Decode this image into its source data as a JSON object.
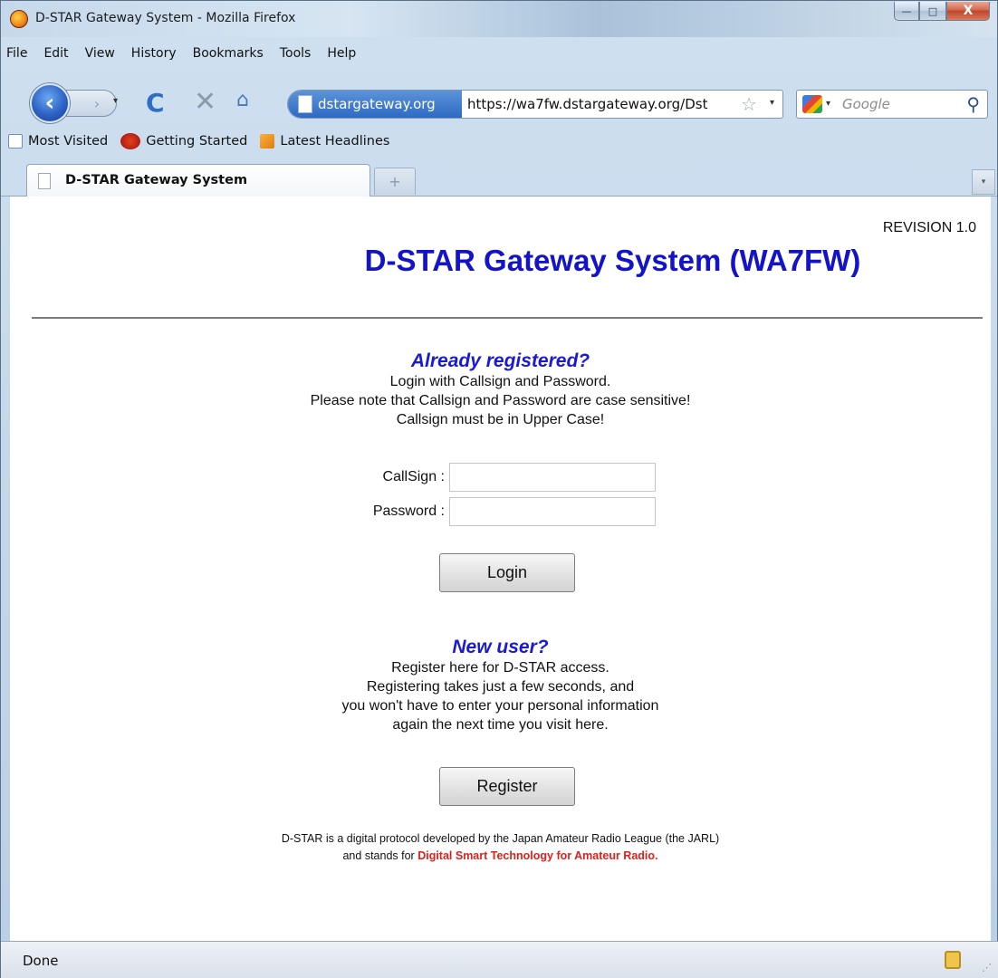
{
  "window": {
    "title": "D-STAR Gateway System - Mozilla Firefox",
    "min_icon": "—",
    "max_icon": "□",
    "close_icon": "X"
  },
  "menu": [
    "File",
    "Edit",
    "View",
    "History",
    "Bookmarks",
    "Tools",
    "Help"
  ],
  "nav": {
    "back_glyph": "‹",
    "forward_glyph": "›",
    "dropdown_glyph": "▾",
    "reload_glyph": "C",
    "stop_glyph": "✕",
    "home_glyph": "⌂",
    "identity_label": "dstargateway.org",
    "url": "https://wa7fw.dstargateway.org/Dst",
    "star_glyph": "☆",
    "search_placeholder": "Google",
    "search_glyph": "⚲"
  },
  "bookmarks": [
    "Most Visited",
    "Getting Started",
    "Latest Headlines"
  ],
  "tabs": {
    "active_label": "D-STAR Gateway System",
    "new_tab_glyph": "+",
    "list_glyph": "▾"
  },
  "page": {
    "revision": "REVISION 1.0",
    "title": "D-STAR Gateway System (WA7FW)",
    "login_heading": "Already registered?",
    "login_lines": [
      "Login with Callsign and Password.",
      "Please note that Callsign and Password are case sensitive!",
      "Callsign must be in Upper Case!"
    ],
    "callsign_label": "CallSign :",
    "callsign_value": "",
    "password_label": "Password :",
    "password_value": "",
    "login_button": "Login",
    "new_user_heading": "New user?",
    "new_user_lines": [
      "Register here for D-STAR access.",
      "Registering takes just a few seconds, and",
      "you won't have to enter your personal information",
      "again the next time you visit here."
    ],
    "register_button": "Register",
    "footer_line1": "D-STAR is a digital protocol developed by the Japan Amateur Radio League (the JARL)",
    "footer_line2_prefix": "and stands for ",
    "footer_line2_highlight": "Digital Smart Technology for Amateur Radio."
  },
  "status": {
    "text": "Done",
    "grip_glyph": "⋰"
  },
  "colors": {
    "title_blue": "#1313c9",
    "heading_blue": "#1a1ad6",
    "highlight_red": "#e0201c"
  }
}
